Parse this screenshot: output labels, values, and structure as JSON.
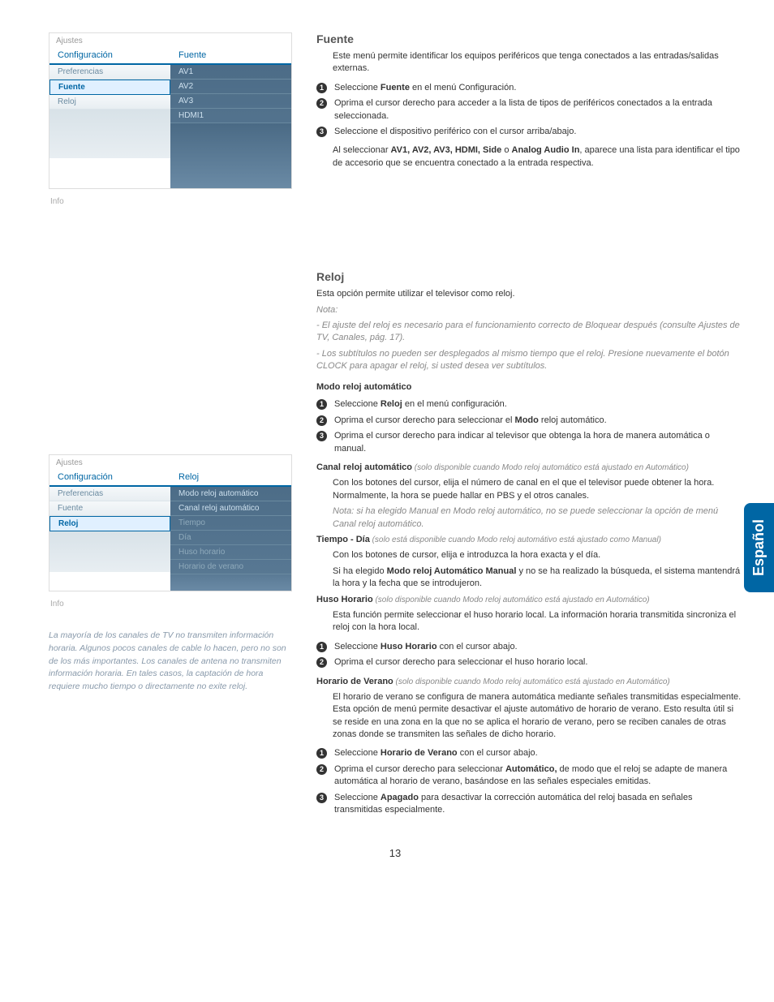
{
  "lang_tab": "Español",
  "page_number": "13",
  "menu1": {
    "title": "Ajustes",
    "left_header": "Configuración",
    "right_header": "Fuente",
    "left_items": [
      "Preferencias",
      "Fuente",
      "Reloj"
    ],
    "selected": "Fuente",
    "right_items": [
      "AV1",
      "AV2",
      "AV3",
      "HDMI1"
    ],
    "info": "Info"
  },
  "menu2": {
    "title": "Ajustes",
    "left_header": "Configuración",
    "right_header": "Reloj",
    "left_items": [
      "Preferencias",
      "Fuente",
      "Reloj"
    ],
    "selected": "Reloj",
    "right_items": [
      "Modo reloj automático",
      "Canal reloj automático",
      "Tiempo",
      "Día",
      "Huso horario",
      "Horario de verano"
    ],
    "info": "Info"
  },
  "side_note": "La mayoría de los canales de TV no transmiten información horaria. Algunos pocos canales de cable lo hacen, pero no son de los más importantes. Los canales de antena no transmiten información horaria. En tales casos, la captación de hora requiere mucho tiempo o directamente no exite reloj.",
  "fuente": {
    "heading": "Fuente",
    "intro": "Este menú permite identificar los equipos periféricos que tenga conectados a las entradas/salidas externas.",
    "step1_a": "Seleccione ",
    "step1_b": "Fuente",
    "step1_c": " en el menú Configuración.",
    "step2": "Oprima el cursor derecho para acceder a la lista de tipos de periféricos conectados a la entrada seleccionada.",
    "step3": "Seleccione el dispositivo periférico con el cursor arriba/abajo.",
    "note_a": "Al seleccionar ",
    "note_b": "AV1, AV2, AV3, HDMI, Side",
    "note_c": " o ",
    "note_d": "Analog Audio In",
    "note_e": ", aparece una lista para identificar el tipo de accesorio que se encuentra conectado a la entrada respectiva."
  },
  "reloj": {
    "heading": "Reloj",
    "intro": "Esta opción permite utilizar el televisor como reloj.",
    "nota_label": "Nota:",
    "nota1": "- El ajuste del reloj es necesario para el funcionamiento correcto de Bloquear después (consulte Ajustes de TV, Canales, pág. 17).",
    "nota2": "-  Los subtítulos no pueden ser desplegados al mismo tiempo que el reloj. Presione nuevamente el botón CLOCK para apagar el reloj, si usted desea ver subtítulos.",
    "modo_heading": "Modo reloj automático",
    "modo_s1_a": "Seleccione ",
    "modo_s1_b": "Reloj",
    "modo_s1_c": " en el menú configuración.",
    "modo_s2_a": "Oprima el cursor derecho para seleccionar el ",
    "modo_s2_b": "Modo",
    "modo_s2_c": " reloj automático.",
    "modo_s3": "Oprima el cursor derecho para indicar al televisor que obtenga la hora de manera automática o manual.",
    "canal_heading": "Canal reloj automático",
    "canal_cond": " (solo disponible cuando Modo reloj automático está ajustado en Automático)",
    "canal_body": "Con los botones del cursor, elija el número de canal en el que el televisor puede obtener la hora. Normalmente, la hora se puede hallar en PBS y el otros canales.",
    "canal_nota": "Nota: si ha elegido Manual en Modo reloj automático, no se puede seleccionar la opción de menú Canal reloj automático.",
    "tiempo_heading": "Tiempo - Día",
    "tiempo_cond": " (solo está disponible cuando Modo reloj automátivo está ajustado como Manual)",
    "tiempo_body1": "Con los botones de cursor, elija e introduzca la hora exacta y el día.",
    "tiempo_body2_a": "Si ha elegido ",
    "tiempo_body2_b": "Modo reloj Automático Manual",
    "tiempo_body2_c": " y no se ha realizado la búsqueda, el sistema mantendrá la hora y la fecha que se introdujeron.",
    "huso_heading": "Huso Horario",
    "huso_cond": " (solo disponible cuando Modo reloj automático está ajustado en Automático)",
    "huso_body": "Esta función permite seleccionar el huso horario local. La información horaria transmitida sincroniza el reloj con la hora local.",
    "huso_s1_a": "Seleccione ",
    "huso_s1_b": "Huso Horario",
    "huso_s1_c": " con el cursor abajo.",
    "huso_s2": "Oprima el cursor derecho para seleccionar el huso horario local.",
    "verano_heading": "Horario de Verano",
    "verano_cond": " (solo disponible cuando Modo reloj automático está ajustado en Automático)",
    "verano_body": "El horario de verano se configura de manera automática mediante señales transmitidas especialmente. Esta opción de menú permite desactivar el ajuste automátivo de horario de verano. Esto resulta útil si se reside en una zona en la que no se aplica el horario de verano, pero se reciben canales de otras zonas donde se transmiten las señales de dicho horario.",
    "verano_s1_a": "Seleccione ",
    "verano_s1_b": "Horario de Verano",
    "verano_s1_c": " con el cursor abajo.",
    "verano_s2_a": "Oprima el cursor derecho para seleccionar ",
    "verano_s2_b": "Automático,",
    "verano_s2_c": " de modo que el reloj se adapte de manera automática al horario de verano, basándose en las señales especiales emitidas.",
    "verano_s3_a": "Seleccione ",
    "verano_s3_b": "Apagado",
    "verano_s3_c": " para desactivar la corrección automática del reloj basada en señales transmitidas especialmente."
  }
}
